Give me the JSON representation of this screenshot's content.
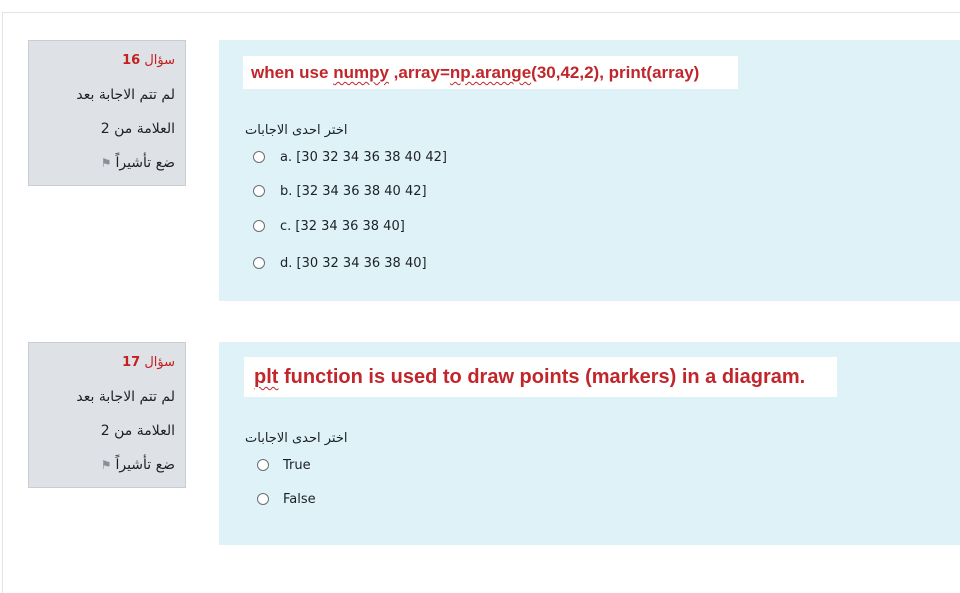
{
  "questions": [
    {
      "number_prefix": "سؤال",
      "number": "16",
      "status": "لم تتم الاجابة بعد",
      "mark": "العلامة من 2",
      "flag": "ضع تأشيراً",
      "text_parts": [
        "when use ",
        "numpy",
        " ,array=",
        "np.arange",
        "(30,42,2), print(array)"
      ],
      "prompt": "اختر احدى الاجابات",
      "options": [
        "a. [30 32 34 36 38 40 42]",
        "b. [32 34 36 38 40 42]",
        "c. [32 34 36 38 40]",
        "d. [30 32 34 36 38 40]"
      ]
    },
    {
      "number_prefix": "سؤال",
      "number": "17",
      "status": "لم تتم الاجابة بعد",
      "mark": "العلامة من 2",
      "flag": "ضع تأشيراً",
      "text_parts": [
        "plt",
        " function is used to draw points (markers) in a diagram."
      ],
      "prompt": "اختر احدى الاجابات",
      "options": [
        "True",
        "False"
      ]
    }
  ],
  "icons": {
    "flag": "flag-icon"
  },
  "colors": {
    "question_text": "#c1262b",
    "content_bg": "#def2f8",
    "info_bg": "#dee2e6"
  }
}
